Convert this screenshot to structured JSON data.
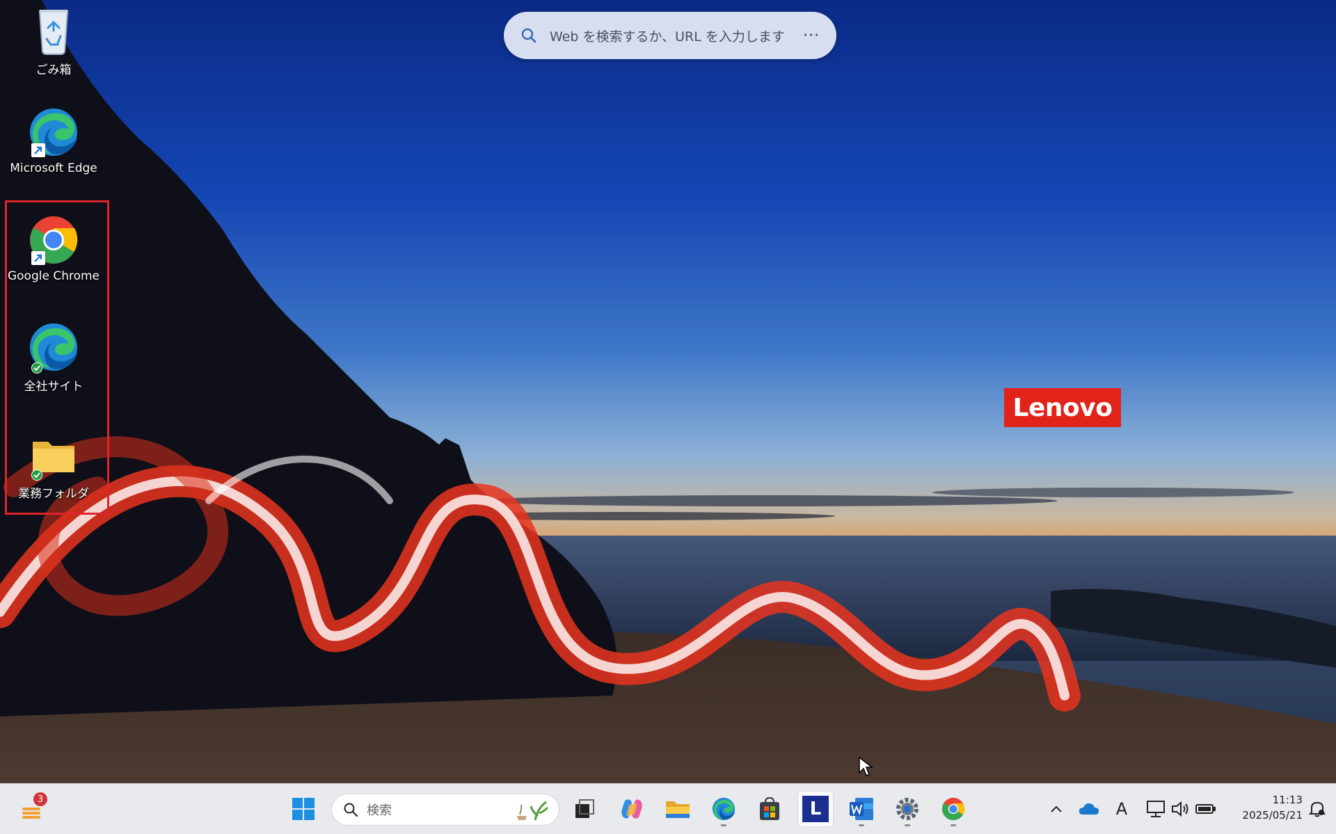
{
  "desktop": {
    "icons": [
      {
        "label": "ごみ箱",
        "icon": "recycle-bin-icon"
      },
      {
        "label": "Microsoft Edge",
        "icon": "edge-icon"
      },
      {
        "label": "Google Chrome",
        "icon": "chrome-icon"
      },
      {
        "label": "全社サイト",
        "icon": "edge-icon"
      },
      {
        "label": "業務フォルダ",
        "icon": "folder-icon"
      }
    ],
    "highlight_color": "#e0242b"
  },
  "web_search": {
    "placeholder": "Web を検索するか、URL を入力します",
    "more": "···"
  },
  "wallpaper": {
    "brand": "Lenovo",
    "brand_color": "#e2231a"
  },
  "taskbar": {
    "widgets_badge": "3",
    "search_placeholder": "検索",
    "launcher_label": "L",
    "apps": [
      "start-icon",
      "task-view-icon",
      "copilot-icon",
      "file-explorer-icon",
      "edge-icon",
      "store-icon",
      "launcher-icon",
      "word-icon",
      "settings-icon",
      "chrome-icon"
    ],
    "tray": {
      "ime": "A",
      "time": "11:13",
      "date": "2025/05/21"
    }
  }
}
